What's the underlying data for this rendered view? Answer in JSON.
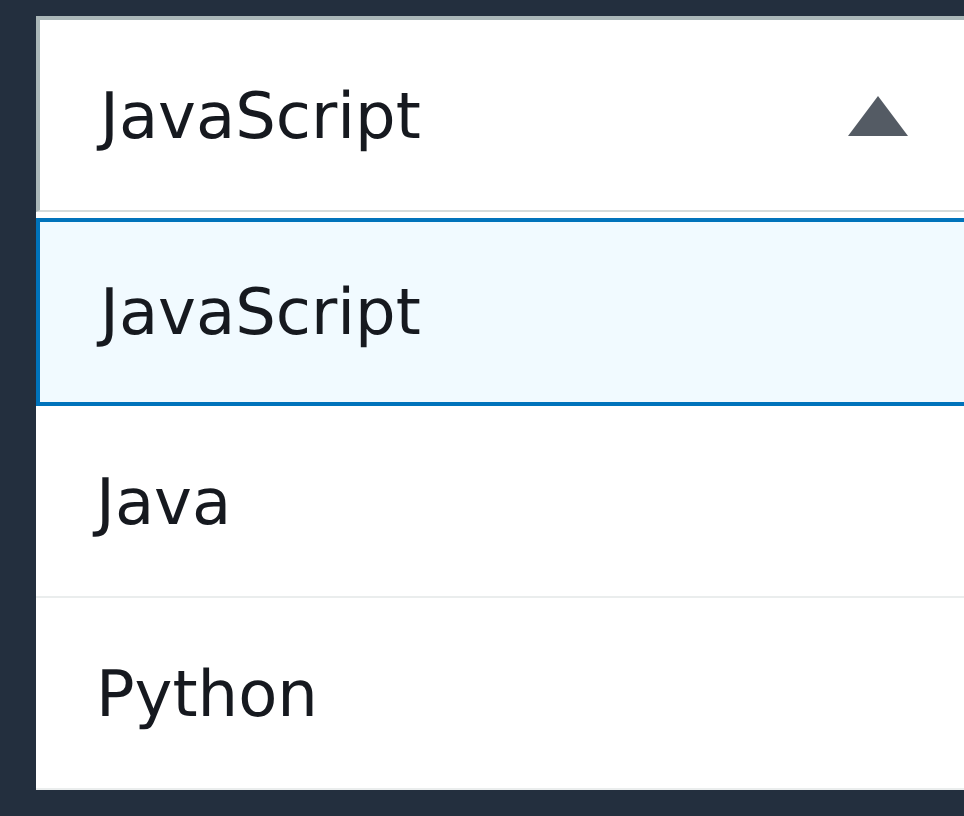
{
  "select": {
    "value": "JavaScript",
    "expanded": true
  },
  "options": [
    {
      "label": "JavaScript",
      "selected": true
    },
    {
      "label": "Java",
      "selected": false
    },
    {
      "label": "Python",
      "selected": false
    }
  ]
}
